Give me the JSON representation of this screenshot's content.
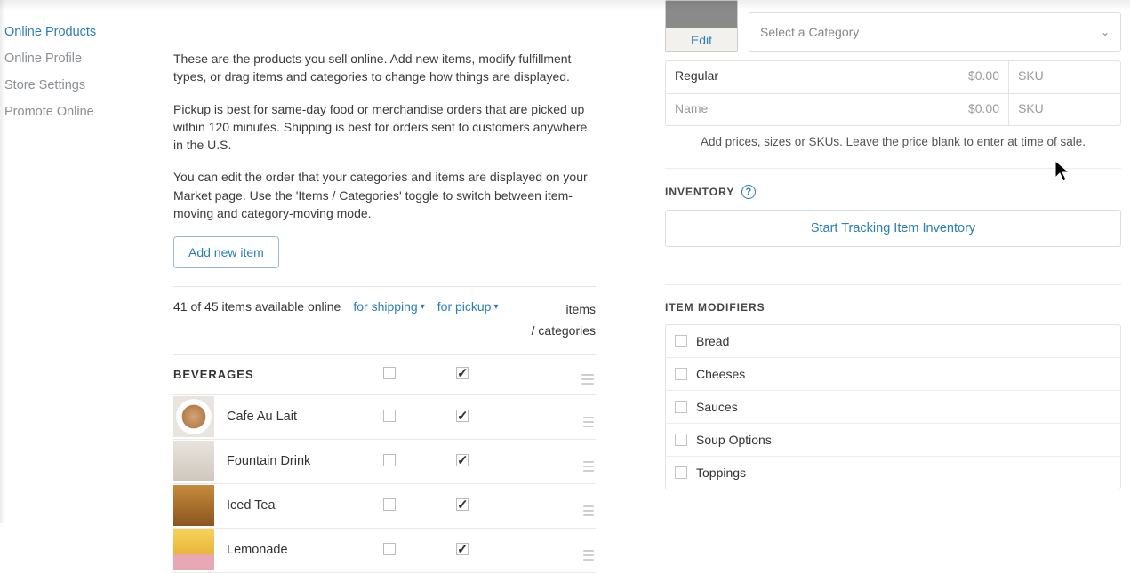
{
  "sidebar": {
    "items": [
      {
        "label": "Online Products",
        "active": true
      },
      {
        "label": "Online Profile",
        "active": false
      },
      {
        "label": "Store Settings",
        "active": false
      },
      {
        "label": "Promote Online",
        "active": false
      }
    ]
  },
  "main": {
    "intro1": "These are the products you sell online. Add new items, modify fulfillment types, or drag items and categories to change how things are displayed.",
    "intro2": "Pickup is best for same-day food or merchandise orders that are picked up within 120 minutes. Shipping is best for orders sent to customers anywhere in the U.S.",
    "intro3": "You can edit the order that your categories and items are displayed on your Market page. Use the 'Items / Categories' toggle to switch between item-moving and category-moving mode.",
    "add_btn": "Add new item",
    "count_text": "41 of 45 items available online",
    "filter_shipping": "for shipping",
    "filter_pickup": "for pickup",
    "toggle_items": "items",
    "toggle_categories": "/ categories",
    "category_header": "BEVERAGES",
    "items": [
      {
        "name": "Cafe Au Lait"
      },
      {
        "name": "Fountain Drink"
      },
      {
        "name": "Iced Tea"
      },
      {
        "name": "Lemonade"
      }
    ]
  },
  "right": {
    "edit_label": "Edit",
    "category_placeholder": "Select a Category",
    "variants": [
      {
        "name": "Regular",
        "price": "$0.00",
        "sku": "SKU"
      },
      {
        "name_placeholder": "Name",
        "price": "$0.00",
        "sku": "SKU"
      }
    ],
    "variant_help": "Add prices, sizes or SKUs. Leave the price blank to enter at time of sale.",
    "inventory_label": "INVENTORY",
    "inventory_btn": "Start Tracking Item Inventory",
    "modifiers_label": "ITEM MODIFIERS",
    "modifiers": [
      {
        "name": "Bread"
      },
      {
        "name": "Cheeses"
      },
      {
        "name": "Sauces"
      },
      {
        "name": "Soup Options"
      },
      {
        "name": "Toppings"
      }
    ]
  }
}
